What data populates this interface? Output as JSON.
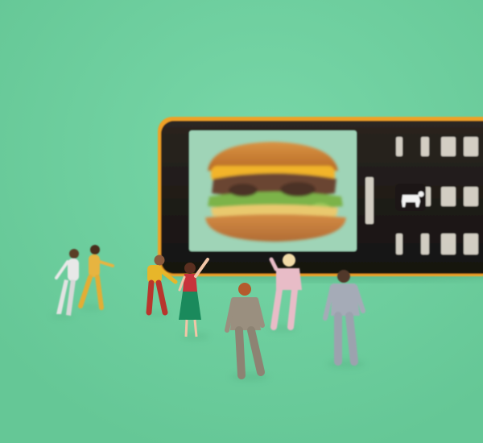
{
  "scene": {
    "description_kind": "photograph",
    "background_color": "#6fcf9f",
    "phone": {
      "body_color": "#1e1a16",
      "trim_color": "#f0a126",
      "screen_bg": "#9fd4b7",
      "screen_content": "burger-image",
      "key_icon": "cow-icon"
    },
    "figurines": [
      {
        "id": "figure-white",
        "outfit": "#e8e8e8"
      },
      {
        "id": "figure-yellow",
        "outfit": "#e7b440"
      },
      {
        "id": "figure-red-yellow",
        "top": "#e7b62a",
        "bottom": "#b8362d"
      },
      {
        "id": "figure-dress",
        "top": "#c7333b",
        "bottom": "#1a8a5c"
      },
      {
        "id": "figure-pink",
        "outfit": "#e8bcc7"
      },
      {
        "id": "figure-tan",
        "outfit": "#9a8f7f"
      },
      {
        "id": "figure-gray",
        "outfit": "#a5abb7"
      }
    ]
  }
}
